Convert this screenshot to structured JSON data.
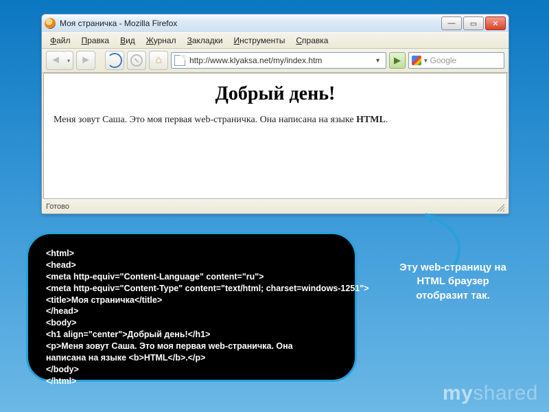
{
  "titlebar": {
    "title": "Моя страничка - Mozilla Firefox"
  },
  "menubar": {
    "items": [
      {
        "u": "Ф",
        "rest": "айл"
      },
      {
        "u": "П",
        "rest": "равка"
      },
      {
        "u": "В",
        "rest": "ид"
      },
      {
        "u": "Ж",
        "rest": "урнал"
      },
      {
        "u": "З",
        "rest": "акладки"
      },
      {
        "u": "И",
        "rest": "нструменты"
      },
      {
        "u": "С",
        "rest": "правка"
      }
    ]
  },
  "addressbar": {
    "url": "http://www.klyaksa.net/my/index.htm",
    "search_placeholder": "Google"
  },
  "page": {
    "heading": "Добрый день!",
    "para_plain": "Меня зовут Саша. Это моя первая web-страничка. Она написана на языке ",
    "para_bold": "HTML",
    "para_tail": "."
  },
  "statusbar": {
    "text": "Готово"
  },
  "caption": {
    "text": "Эту web-страницу на HTML браузер отобразит так."
  },
  "code": {
    "l1": "<html>",
    "l2": "<head>",
    "l3": "<meta http-equiv=\"Content-Language\" content=\"ru\">",
    "l4": "<meta http-equiv=\"Content-Type\" content=\"text/html; charset=windows-1251\">",
    "l5": "<title>Моя страничка</title>",
    "l6": "</head>",
    "l7": "<body>",
    "l8": "<h1 align=\"center\">Добрый день!</h1>",
    "l9a": "<p>Меня зовут Саша. Это моя первая web-страничка. Она",
    "l9b": "написана на языке <b>HTML</b>.</p>",
    "l10": "</body>",
    "l11": "</html>"
  },
  "watermark": {
    "a": "my",
    "b": "shared"
  }
}
